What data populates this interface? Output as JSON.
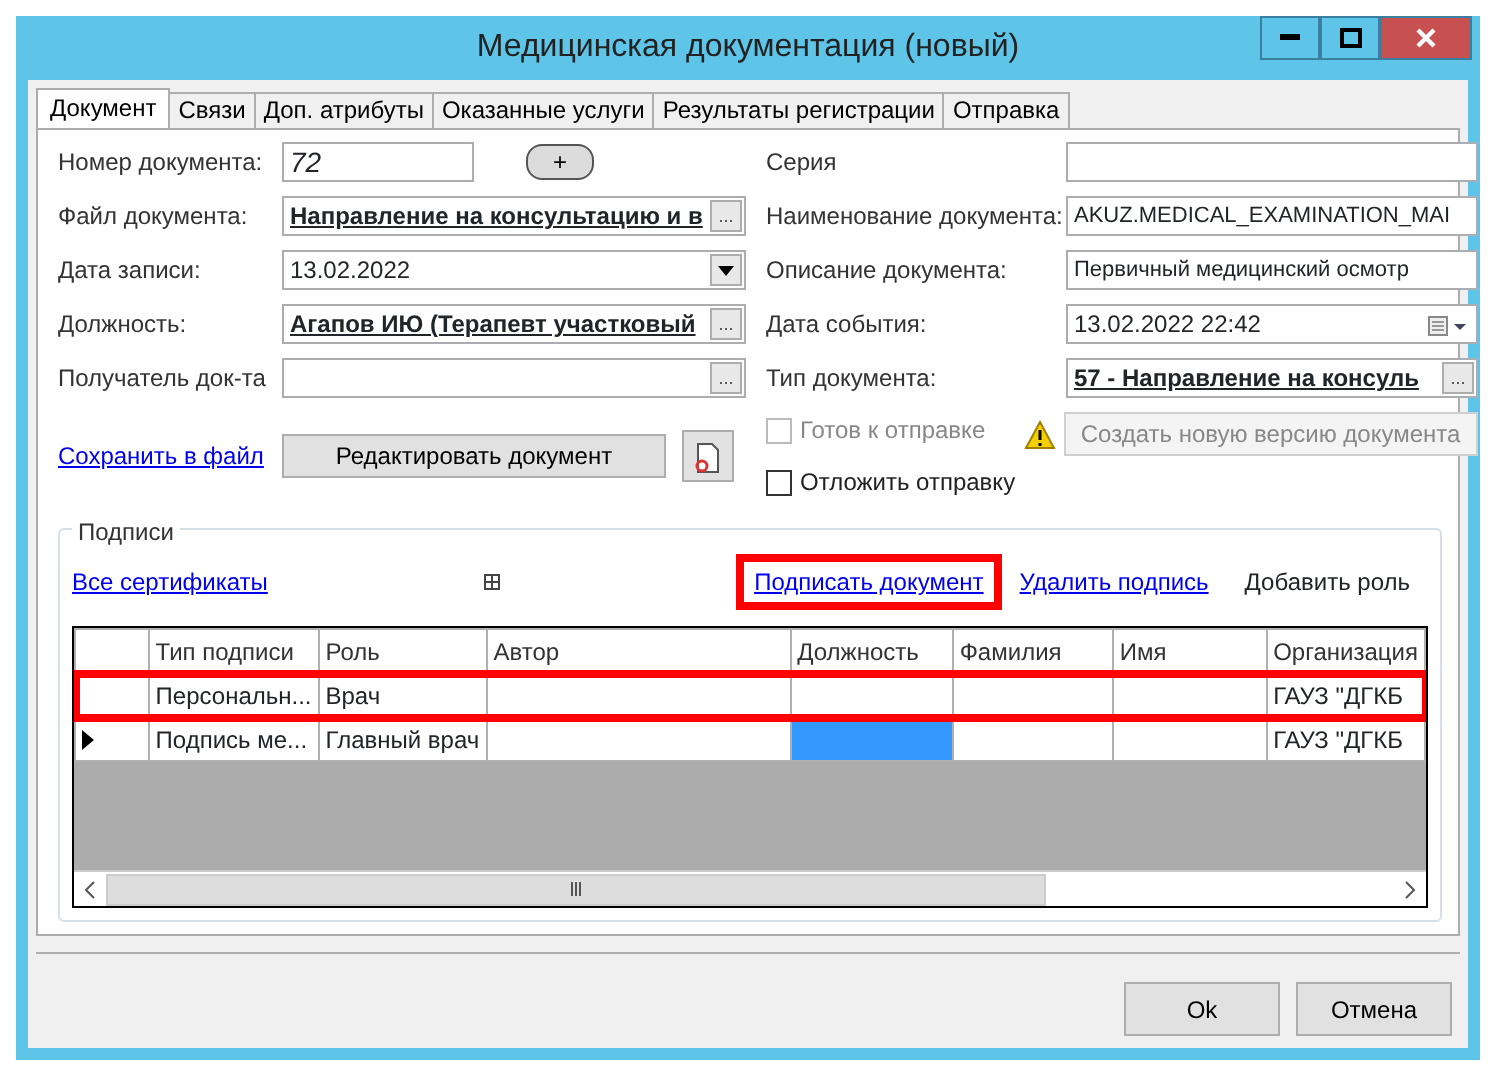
{
  "window": {
    "title": "Медицинская документация (новый)"
  },
  "tabs": [
    {
      "label": "Документ",
      "selected": true
    },
    {
      "label": "Связи",
      "selected": false
    },
    {
      "label": "Доп. атрибуты",
      "selected": false
    },
    {
      "label": "Оказанные услуги",
      "selected": false
    },
    {
      "label": "Результаты регистрации",
      "selected": false
    },
    {
      "label": "Отправка",
      "selected": false
    }
  ],
  "left_fields": [
    {
      "label": "Номер документа:",
      "kind": "number",
      "value": "72",
      "button": "+"
    },
    {
      "label": "Файл документа:",
      "kind": "picker",
      "value": "Направление на консультацию и в",
      "button": "..."
    },
    {
      "label": "Дата записи:",
      "kind": "dropdown",
      "value": "13.02.2022"
    },
    {
      "label": "Должность:",
      "kind": "picker",
      "value": "Агапов ИЮ (Терапевт участковый",
      "button": "..."
    },
    {
      "label": "Получатель док-та",
      "kind": "picker",
      "button": "..."
    }
  ],
  "right_fields": [
    {
      "label": "Серия",
      "kind": "text"
    },
    {
      "label": "Наименование документа:",
      "kind": "text",
      "value": "AKUZ.MEDICAL_EXAMINATION_MAI"
    },
    {
      "label": "Описание документа:",
      "kind": "text",
      "value": "Первичный медицинский осмотр"
    },
    {
      "label": "Дата события:",
      "kind": "datetime",
      "value": "13.02.2022 22:42"
    },
    {
      "label": "Тип документа:",
      "kind": "picker",
      "value": "57 - Направление на консуль",
      "button": "..."
    }
  ],
  "save_link": "Сохранить в файл",
  "edit_button": "Редактировать документ",
  "checkboxes": [
    {
      "label": "Готов к отправке",
      "checked": false,
      "disabled": true
    },
    {
      "label": "Отложить отправку",
      "checked": false,
      "disabled": false
    }
  ],
  "new_version_button": {
    "label": "Создать новую версию документа",
    "disabled": true
  },
  "signatures": {
    "title": "Подписи",
    "all_certs": "Все сертификаты",
    "actions": [
      {
        "label": "Подписать документ",
        "kind": "link",
        "highlighted": true
      },
      {
        "label": "Удалить подпись",
        "kind": "link",
        "highlighted": false
      },
      {
        "label": "Добавить роль",
        "kind": "text",
        "highlighted": false
      }
    ],
    "columns": [
      "Тип подписи",
      "Роль",
      "Автор",
      "Должность",
      "Фамилия",
      "Имя",
      "Организация"
    ],
    "rows": [
      {
        "current": false,
        "highlighted": true,
        "cells": [
          {
            "text": "Персональн...",
            "selected": false
          },
          {
            "text": "Врач",
            "selected": false
          },
          {
            "text": "",
            "selected": false
          },
          {
            "text": "",
            "selected": false
          },
          {
            "text": "",
            "selected": false
          },
          {
            "text": "",
            "selected": false
          },
          {
            "text": "ГАУЗ \"ДГКБ",
            "selected": false
          }
        ]
      },
      {
        "current": true,
        "highlighted": false,
        "cells": [
          {
            "text": "Подпись ме...",
            "selected": false
          },
          {
            "text": "Главный врач",
            "selected": false
          },
          {
            "text": "",
            "selected": false
          },
          {
            "text": "",
            "selected": true
          },
          {
            "text": "",
            "selected": false
          },
          {
            "text": "",
            "selected": false
          },
          {
            "text": "ГАУЗ \"ДГКБ",
            "selected": false
          }
        ]
      }
    ]
  },
  "buttons": [
    "Ok",
    "Отмена"
  ]
}
